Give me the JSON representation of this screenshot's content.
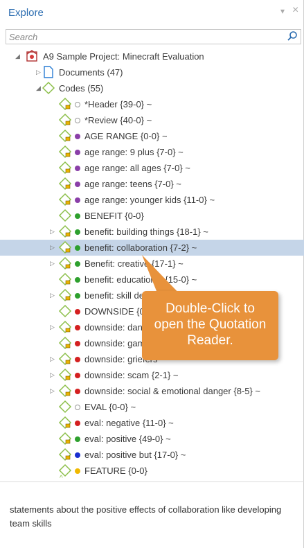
{
  "panel": {
    "title": "Explore",
    "pin_glyph": "▾",
    "close_glyph": "×"
  },
  "search": {
    "placeholder": "Search"
  },
  "tree": [
    {
      "label": "A9 Sample Project: Minecraft Evaluation",
      "kind": "project",
      "twisty": "◢"
    },
    {
      "label": "Documents (47)",
      "kind": "doc",
      "twisty": "▷"
    },
    {
      "label": "Codes (55)",
      "kind": "codes",
      "twisty": "◢"
    },
    {
      "label": "*Header {39-0} ~",
      "kind": "code",
      "color": "none"
    },
    {
      "label": "*Review {40-0} ~",
      "kind": "code",
      "color": "none"
    },
    {
      "label": "AGE RANGE {0-0} ~",
      "kind": "code",
      "color": "#8a3fa8"
    },
    {
      "label": "age range: 9 plus {7-0} ~",
      "kind": "code",
      "color": "#8a3fa8"
    },
    {
      "label": "age range: all ages {7-0} ~",
      "kind": "code",
      "color": "#8a3fa8"
    },
    {
      "label": "age range: teens {7-0} ~",
      "kind": "code",
      "color": "#8a3fa8"
    },
    {
      "label": "age range: younger kids {11-0} ~",
      "kind": "code",
      "color": "#8a3fa8"
    },
    {
      "label": "BENEFIT {0-0}",
      "kind": "code-plain",
      "color": "#2ea02e"
    },
    {
      "label": "benefit: building things {18-1} ~",
      "kind": "code",
      "color": "#2ea02e",
      "twisty": "▷"
    },
    {
      "label": "benefit: collaboration {7-2} ~",
      "kind": "code",
      "color": "#2ea02e",
      "twisty": "▷",
      "selected": true
    },
    {
      "label": "Benefit: creative {17-1} ~",
      "kind": "code",
      "color": "#2ea02e",
      "twisty": "▷"
    },
    {
      "label": "benefit: educational {15-0} ~",
      "kind": "code",
      "color": "#2ea02e"
    },
    {
      "label": "benefit: skill development",
      "kind": "code",
      "color": "#2ea02e",
      "twisty": "▷"
    },
    {
      "label": "DOWNSIDE {0-0}",
      "kind": "code-plain",
      "color": "#d42020"
    },
    {
      "label": "downside: dangers",
      "kind": "code",
      "color": "#d42020",
      "twisty": "▷"
    },
    {
      "label": "downside: gaming",
      "kind": "code",
      "color": "#d42020"
    },
    {
      "label": "downside: griefers",
      "kind": "code",
      "color": "#d42020",
      "twisty": "▷"
    },
    {
      "label": "downside: scam {2-1} ~",
      "kind": "code",
      "color": "#d42020",
      "twisty": "▷"
    },
    {
      "label": "downside: social & emotional danger {8-5} ~",
      "kind": "code",
      "color": "#d42020",
      "twisty": "▷"
    },
    {
      "label": "EVAL {0-0} ~",
      "kind": "code-plain",
      "color": "none"
    },
    {
      "label": "eval: negative {11-0} ~",
      "kind": "code",
      "color": "#d42020"
    },
    {
      "label": "eval: positive {49-0} ~",
      "kind": "code",
      "color": "#2ea02e"
    },
    {
      "label": "eval: positive but {17-0} ~",
      "kind": "code",
      "color": "#1a2fd0"
    },
    {
      "label": "FEATURE {0-0}",
      "kind": "code-plain",
      "color": "#f0b800"
    }
  ],
  "comment": {
    "text": "statements about the positive effects of collaboration like developing team skills"
  },
  "callout": {
    "line1": "Double-Click to",
    "line2": "open the Quotation",
    "line3": "Reader.",
    "color": "#e8923b"
  },
  "icons": {
    "search": "search-icon",
    "code": "code-tag-icon",
    "project": "project-icon",
    "documents": "documents-icon",
    "codes": "codes-icon"
  }
}
